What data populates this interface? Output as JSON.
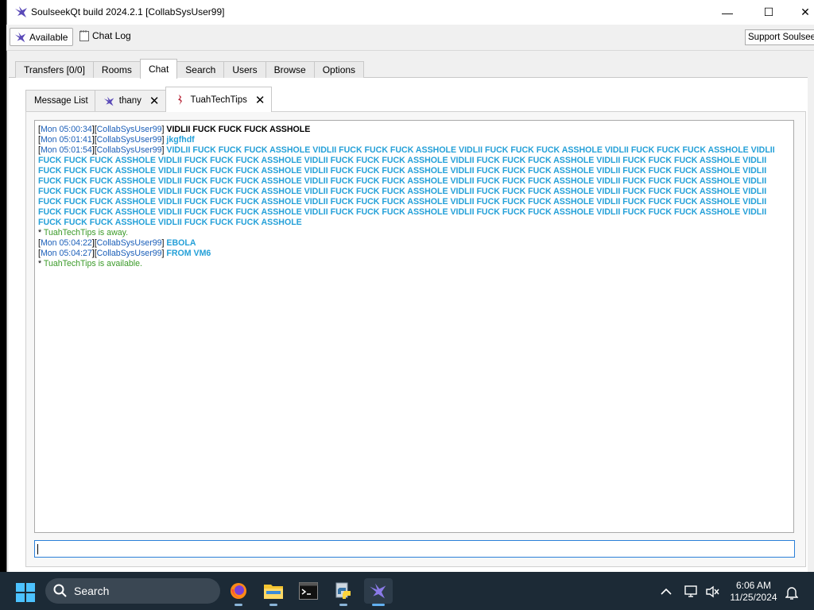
{
  "window": {
    "title": "SoulseekQt build 2024.2.1 [CollabSysUser99]",
    "minimize_glyph": "—",
    "maximize_glyph": "☐",
    "close_glyph": "✕"
  },
  "toolbar": {
    "available_label": "Available",
    "chatlog_label": "Chat Log",
    "support_label": "Support Soulseek"
  },
  "main_tabs": [
    {
      "label": "Transfers [0/0]",
      "active": false
    },
    {
      "label": "Rooms",
      "active": false
    },
    {
      "label": "Chat",
      "active": true
    },
    {
      "label": "Search",
      "active": false
    },
    {
      "label": "Users",
      "active": false
    },
    {
      "label": "Browse",
      "active": false
    },
    {
      "label": "Options",
      "active": false
    }
  ],
  "sub_tabs": {
    "message_list": "Message List",
    "thany": "thany",
    "tuah": "TuahTechTips",
    "close_glyph": "✕"
  },
  "chat": {
    "open_bracket": "[",
    "close_bracket": "]",
    "lines": [
      {
        "time": "Mon 05:00:34",
        "user": "CollabSysUser99",
        "text": "VIDLII FUCK FUCK FUCK ASSHOLE",
        "kind": "self"
      },
      {
        "time": "Mon 05:01:41",
        "user": "CollabSysUser99",
        "text": "jkgfhdf",
        "kind": "other"
      },
      {
        "time": "Mon 05:01:54",
        "user": "CollabSysUser99",
        "text": "VIDLII FUCK FUCK FUCK ASSHOLE VIDLII FUCK FUCK FUCK ASSHOLE VIDLII FUCK FUCK FUCK ASSHOLE VIDLII FUCK FUCK FUCK ASSHOLE VIDLII FUCK FUCK FUCK ASSHOLE VIDLII FUCK FUCK FUCK ASSHOLE VIDLII FUCK FUCK FUCK ASSHOLE VIDLII FUCK FUCK FUCK ASSHOLE VIDLII FUCK FUCK FUCK ASSHOLE VIDLII FUCK FUCK FUCK ASSHOLE VIDLII FUCK FUCK FUCK ASSHOLE VIDLII FUCK FUCK FUCK ASSHOLE VIDLII FUCK FUCK FUCK ASSHOLE VIDLII FUCK FUCK FUCK ASSHOLE VIDLII FUCK FUCK FUCK ASSHOLE VIDLII FUCK FUCK FUCK ASSHOLE VIDLII FUCK FUCK FUCK ASSHOLE VIDLII FUCK FUCK FUCK ASSHOLE VIDLII FUCK FUCK FUCK ASSHOLE VIDLII FUCK FUCK FUCK ASSHOLE VIDLII FUCK FUCK FUCK ASSHOLE VIDLII FUCK FUCK FUCK ASSHOLE VIDLII FUCK FUCK FUCK ASSHOLE VIDLII FUCK FUCK FUCK ASSHOLE VIDLII FUCK FUCK FUCK ASSHOLE VIDLII FUCK FUCK FUCK ASSHOLE VIDLII FUCK FUCK FUCK ASSHOLE VIDLII FUCK FUCK FUCK ASSHOLE VIDLII FUCK FUCK FUCK ASSHOLE VIDLII FUCK FUCK FUCK ASSHOLE VIDLII FUCK FUCK FUCK ASSHOLE VIDLII FUCK FUCK FUCK ASSHOLE VIDLII FUCK FUCK FUCK ASSHOLE VIDLII FUCK FUCK FUCK ASSHOLE VIDLII FUCK FUCK FUCK ASSHOLE VIDLII FUCK FUCK FUCK ASSHOLE",
        "kind": "other"
      },
      {
        "star": "*",
        "status": "TuahTechTips is away.",
        "kind": "status"
      },
      {
        "time": "Mon 05:04:22",
        "user": "CollabSysUser99",
        "text": "EBOLA",
        "kind": "other"
      },
      {
        "time": "Mon 05:04:27",
        "user": "CollabSysUser99",
        "text": "FROM VM6",
        "kind": "other"
      },
      {
        "star": "*",
        "status": "TuahTechTips is available.",
        "kind": "status"
      }
    ]
  },
  "taskbar": {
    "search_label": "Search",
    "time": "6:06 AM",
    "date": "11/25/2024"
  }
}
